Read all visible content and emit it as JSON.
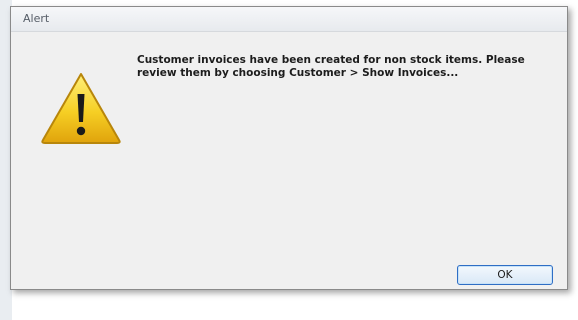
{
  "window": {
    "title": "Alert"
  },
  "dialog": {
    "icon": "warning-triangle-icon",
    "message": "Customer invoices have been created for non stock items. Please review them by choosing Customer > Show Invoices...",
    "ok_label": "OK"
  },
  "colors": {
    "dialog_background": "#f0f0f0",
    "icon_yellow": "#f2c21b",
    "button_border": "#2f6ec5"
  }
}
